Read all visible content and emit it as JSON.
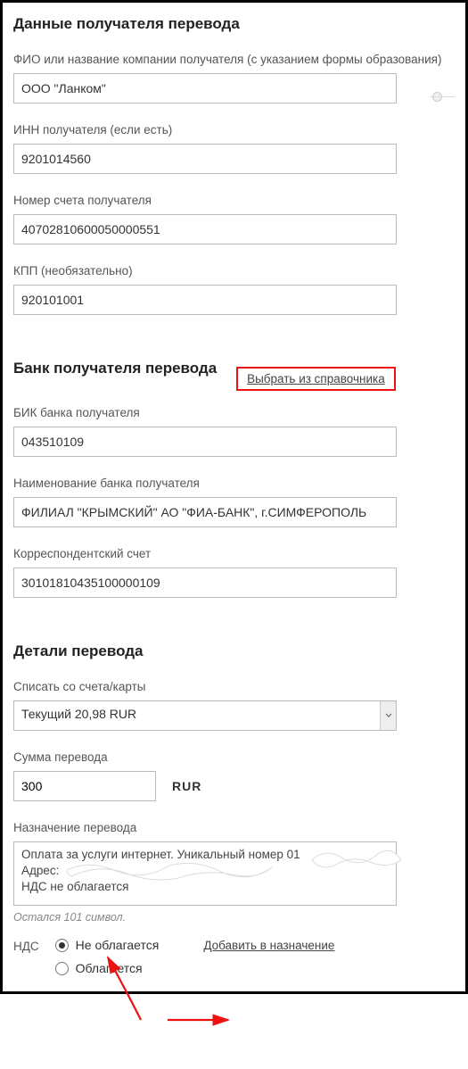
{
  "recipient": {
    "section_title": "Данные получателя перевода",
    "name_label": "ФИО или название компании получателя (с указанием формы образования)",
    "name_value": "ООО \"Ланком\"",
    "inn_label": "ИНН получателя (если есть)",
    "inn_value": "9201014560",
    "account_label": "Номер счета получателя",
    "account_value": "40702810600050000551",
    "kpp_label": "КПП (необязательно)",
    "kpp_value": "920101001"
  },
  "bank": {
    "section_title": "Банк получателя перевода",
    "directory_link": "Выбрать из справочника",
    "bik_label": "БИК банка получателя",
    "bik_value": "043510109",
    "name_label": "Наименование банка получателя",
    "name_value": "ФИЛИАЛ \"КРЫМСКИЙ\" АО \"ФИА-БАНК\", г.СИМФЕРОПОЛЬ",
    "corr_label": "Корреспондентский счет",
    "corr_value": "30101810435100000109"
  },
  "details": {
    "section_title": "Детали перевода",
    "source_label": "Списать со счета/карты",
    "source_value": "Текущий 20,98 RUR",
    "amount_label": "Сумма перевода",
    "amount_value": "300",
    "currency": "RUR",
    "purpose_label": "Назначение перевода",
    "purpose_line1": "Оплата за услуги интернет. Уникальный номер 01",
    "purpose_line2": "Адрес:",
    "purpose_line3": "НДС не облагается",
    "chars_hint": "Остался 101 символ.",
    "nds_label": "НДС",
    "nds_option1": "Не облагается",
    "nds_option2": "Облагается",
    "add_link": "Добавить в назначение"
  }
}
